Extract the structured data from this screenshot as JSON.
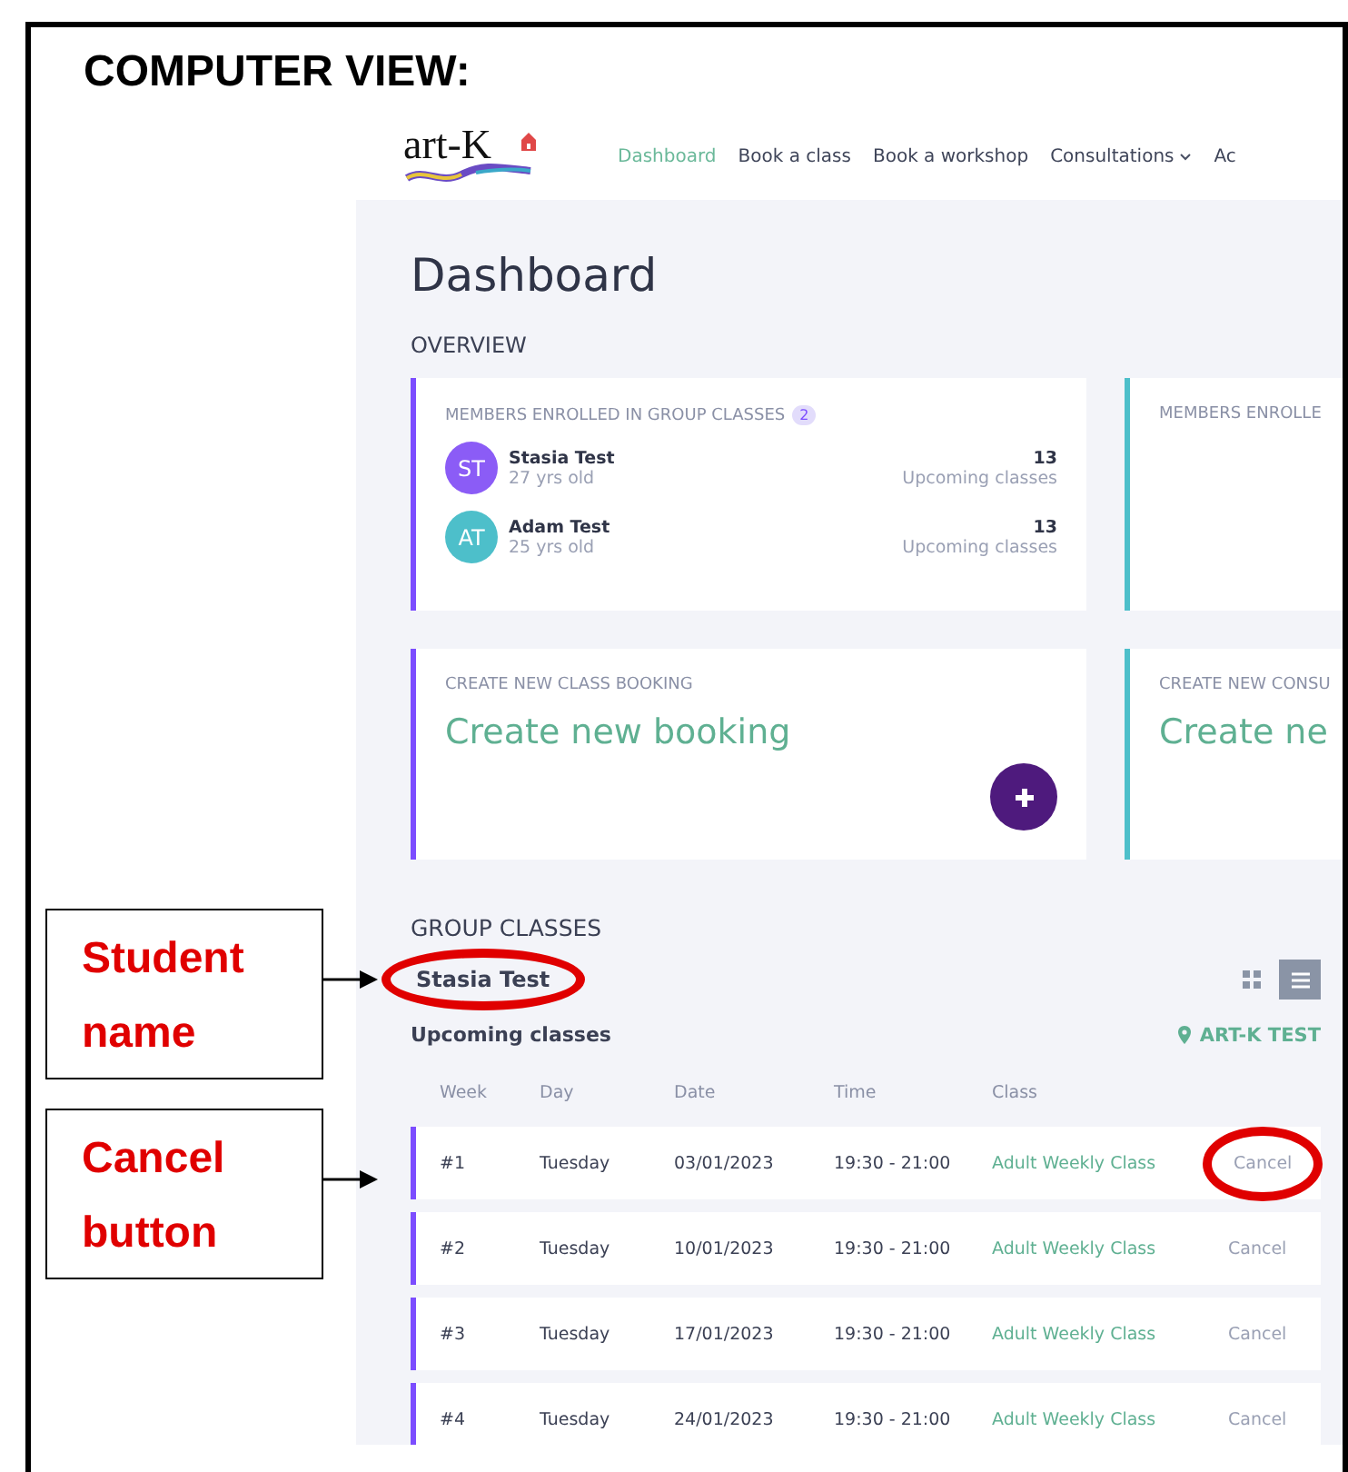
{
  "heading": "COMPUTER VIEW:",
  "annotations": [
    {
      "label": "Student name"
    },
    {
      "label": "Cancel button"
    }
  ],
  "app": {
    "logo": "art-K",
    "nav": [
      {
        "label": "Dashboard",
        "selected": true
      },
      {
        "label": "Book a class",
        "selected": false
      },
      {
        "label": "Book a workshop",
        "selected": false
      },
      {
        "label": "Consultations",
        "selected": false,
        "has_menu": true
      },
      {
        "label": "Ac",
        "selected": false
      }
    ],
    "page_title": "Dashboard",
    "overview_label": "OVERVIEW",
    "member_cards": [
      {
        "title": "MEMBERS ENROLLED IN GROUP CLASSES",
        "count": "2",
        "color": "#7c4dff",
        "members": [
          {
            "initials": "ST",
            "name": "Stasia Test",
            "age": "27 yrs old",
            "upcoming_count": "13",
            "upcoming_label": "Upcoming classes",
            "color": "#8b5cf6"
          },
          {
            "initials": "AT",
            "name": "Adam Test",
            "age": "25 yrs old",
            "upcoming_count": "13",
            "upcoming_label": "Upcoming classes",
            "color": "#4dbfca"
          }
        ]
      },
      {
        "title": "MEMBERS ENROLLE",
        "color": "#4dbfca"
      }
    ],
    "booking_cards": [
      {
        "title": "CREATE NEW CLASS BOOKING",
        "action": "Create new booking",
        "color": "#7c4dff",
        "add_button": true
      },
      {
        "title": "CREATE NEW CONSU",
        "action": "Create ne",
        "color": "#4dbfca",
        "add_button": false
      }
    ],
    "group_classes": {
      "label": "GROUP CLASSES",
      "student": "Stasia Test",
      "views": [
        {
          "kind": "grid",
          "selected": false
        },
        {
          "kind": "list",
          "selected": true
        }
      ],
      "subtitle": "Upcoming classes",
      "location": "ART-K TEST",
      "columns": [
        "Week",
        "Day",
        "Date",
        "Time",
        "Class"
      ],
      "rows": [
        {
          "week": "#1",
          "day": "Tuesday",
          "date": "03/01/2023",
          "time": "19:30 - 21:00",
          "class": "Adult Weekly Class",
          "action": "Cancel"
        },
        {
          "week": "#2",
          "day": "Tuesday",
          "date": "10/01/2023",
          "time": "19:30 - 21:00",
          "class": "Adult Weekly Class",
          "action": "Cancel"
        },
        {
          "week": "#3",
          "day": "Tuesday",
          "date": "17/01/2023",
          "time": "19:30 - 21:00",
          "class": "Adult Weekly Class",
          "action": "Cancel"
        },
        {
          "week": "#4",
          "day": "Tuesday",
          "date": "24/01/2023",
          "time": "19:30 - 21:00",
          "class": "Adult Weekly Class",
          "action": "Cancel"
        }
      ]
    }
  }
}
